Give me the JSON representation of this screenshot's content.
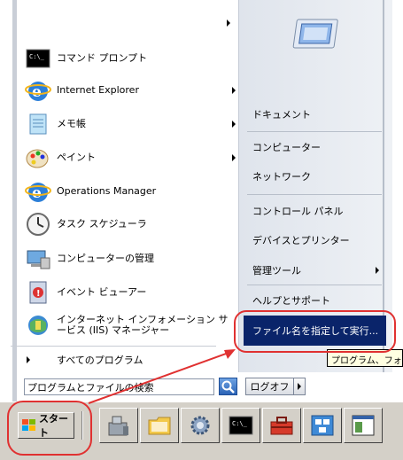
{
  "programs": [
    {
      "label": "コマンド プロンプト",
      "icon": "cmd-icon",
      "submenu": false
    },
    {
      "label": "Internet Explorer",
      "icon": "ie-icon",
      "submenu": true
    },
    {
      "label": "メモ帳",
      "icon": "notepad-icon",
      "submenu": true
    },
    {
      "label": "ペイント",
      "icon": "paint-icon",
      "submenu": true
    },
    {
      "label": "Operations Manager",
      "icon": "ie-icon",
      "submenu": false
    },
    {
      "label": "タスク スケジューラ",
      "icon": "clock-icon",
      "submenu": false
    },
    {
      "label": "コンピューターの管理",
      "icon": "computer-manage-icon",
      "submenu": false
    },
    {
      "label": "イベント ビューアー",
      "icon": "event-viewer-icon",
      "submenu": false
    },
    {
      "label": "インターネット インフォメーション サービス (IIS) マネージャー",
      "icon": "iis-icon",
      "submenu": false
    }
  ],
  "all_programs": "すべてのプログラム",
  "search": {
    "value": "プログラムとファイルの検索"
  },
  "logoff": "ログオフ",
  "right": {
    "documents": "ドキュメント",
    "computer": "コンピューター",
    "network": "ネットワーク",
    "control_panel": "コントロール パネル",
    "devices": "デバイスとプリンター",
    "admin_tools": "管理ツール",
    "help": "ヘルプとサポート",
    "run": "ファイル名を指定して実行..."
  },
  "tooltip": "プログラム、フォルダー",
  "start": "スタート",
  "taskbar_icons": [
    "server-manager-icon",
    "explorer-folder-icon",
    "settings-gear-icon",
    "cmd-icon",
    "toolbox-icon",
    "network-icon",
    "app-window-icon"
  ],
  "colors": {
    "highlight": "#0a246a",
    "annotation": "#e03131"
  }
}
